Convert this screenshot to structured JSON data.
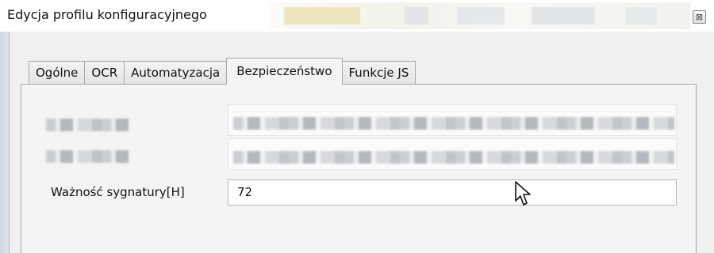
{
  "window": {
    "title": "Edycja profilu konfiguracyjnego",
    "close_glyph": "⊠"
  },
  "tabs": [
    {
      "label": "Ogólne",
      "active": false
    },
    {
      "label": "OCR",
      "active": false
    },
    {
      "label": "Automatyzacja",
      "active": false
    },
    {
      "label": "Bezpieczeństwo",
      "active": true
    },
    {
      "label": "Funkcje JS",
      "active": false
    }
  ],
  "form": {
    "signature_validity_label": "Ważność sygnatury[H]",
    "signature_validity_value": "72"
  },
  "icons": {
    "close": "close-icon",
    "cursor": "mouse-pointer-icon"
  },
  "colors": {
    "panel_background": "#f4f4f4",
    "tab_border": "#a8a8a8",
    "input_background": "#ffffff"
  }
}
